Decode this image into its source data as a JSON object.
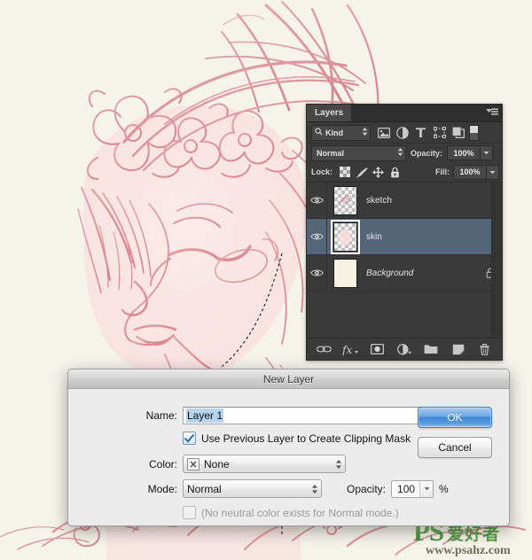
{
  "app": {
    "artwork_alt": "pink line-art sketch of a girl's profile with a flower crown",
    "canvas_bg": "#f5f3ea",
    "ink_color": "#d98a93"
  },
  "layers_panel": {
    "tab_label": "Layers",
    "panel_menu_icon": "panel-menu-icon",
    "filter": {
      "search_icon": "search-icon",
      "kind_label": "Kind",
      "stepper_icon": "updown-stepper-icon",
      "icons": [
        {
          "name": "filter-pixel-layers-icon",
          "glyph": "image"
        },
        {
          "name": "filter-adjustment-layers-icon",
          "glyph": "adjustment"
        },
        {
          "name": "filter-type-layers-icon",
          "glyph": "type"
        },
        {
          "name": "filter-shape-layers-icon",
          "glyph": "shape"
        },
        {
          "name": "filter-smart-object-icon",
          "glyph": "smart-object"
        }
      ],
      "toggle_name": "filter-enable-toggle"
    },
    "blend": {
      "mode_value": "Normal",
      "opacity_label": "Opacity:",
      "opacity_value": "100%"
    },
    "lock": {
      "label": "Lock:",
      "icons": [
        {
          "name": "lock-transparent-pixels-icon"
        },
        {
          "name": "lock-image-pixels-icon"
        },
        {
          "name": "lock-position-icon"
        },
        {
          "name": "lock-all-icon"
        }
      ],
      "fill_label": "Fill:",
      "fill_value": "100%"
    },
    "layers": [
      {
        "name": "sketch",
        "selected": false,
        "visible": true,
        "locked": false,
        "italic": false,
        "thumb": "transparent"
      },
      {
        "name": "skin",
        "selected": true,
        "visible": true,
        "locked": false,
        "italic": false,
        "thumb": "transparent"
      },
      {
        "name": "Background",
        "selected": false,
        "visible": true,
        "locked": true,
        "italic": true,
        "thumb": "solid"
      }
    ],
    "footer_icons": [
      {
        "name": "link-layers-icon"
      },
      {
        "name": "layer-style-fx-icon"
      },
      {
        "name": "add-layer-mask-icon"
      },
      {
        "name": "new-adjustment-layer-icon"
      },
      {
        "name": "new-group-icon"
      },
      {
        "name": "new-layer-icon"
      },
      {
        "name": "delete-layer-icon"
      }
    ]
  },
  "new_layer_dialog": {
    "title": "New Layer",
    "name_label": "Name:",
    "name_value": "Layer 1",
    "clipping_mask_label": "Use Previous Layer to Create Clipping Mask",
    "clipping_mask_checked": true,
    "color_label": "Color:",
    "color_value": "None",
    "mode_label": "Mode:",
    "mode_value": "Normal",
    "opacity_label": "Opacity:",
    "opacity_value": "100",
    "opacity_unit": "%",
    "neutral_color_note": "(No neutral color exists for Normal mode.)",
    "neutral_checked": false,
    "ok_label": "OK",
    "cancel_label": "Cancel",
    "accent_color": "#3f87d4"
  },
  "watermark": {
    "ps_text": "PS",
    "cn_text": "爱好者",
    "url_text": "www.psahz.com",
    "color": "#5aa04a"
  }
}
